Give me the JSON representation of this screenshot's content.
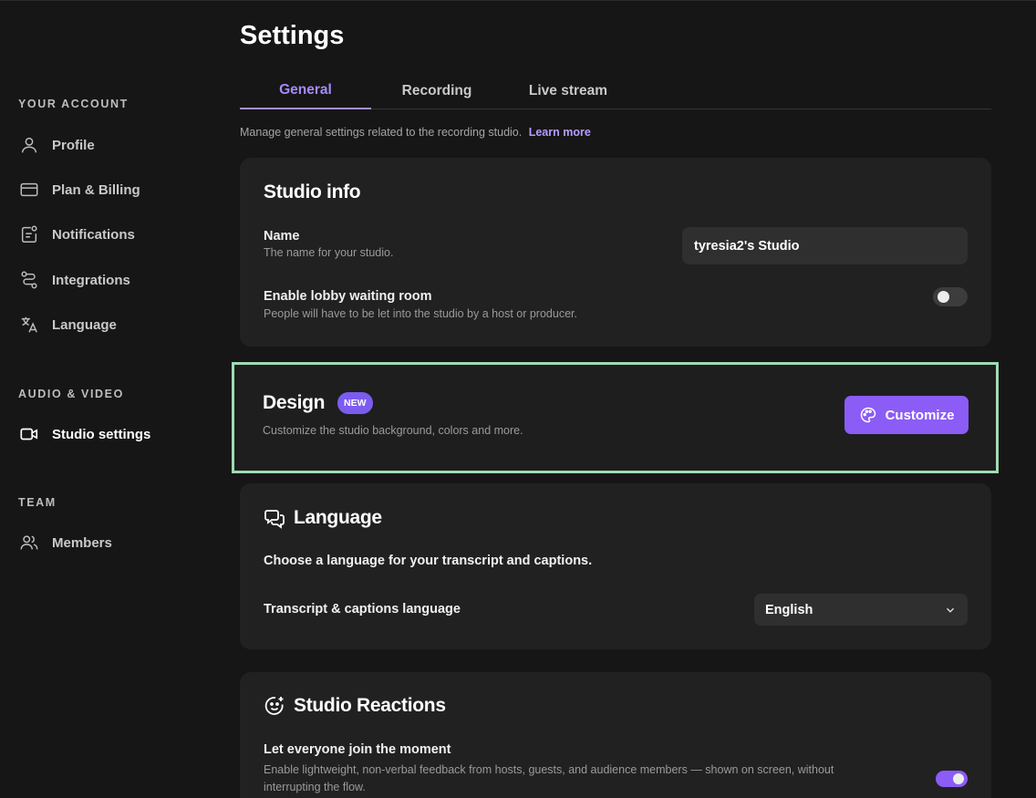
{
  "sidebar": {
    "sections": [
      {
        "heading": "YOUR ACCOUNT",
        "items": [
          {
            "label": "Profile",
            "icon": "user-icon"
          },
          {
            "label": "Plan & Billing",
            "icon": "credit-card-icon"
          },
          {
            "label": "Notifications",
            "icon": "notification-icon"
          },
          {
            "label": "Integrations",
            "icon": "integrations-icon"
          },
          {
            "label": "Language",
            "icon": "translate-icon"
          }
        ]
      },
      {
        "heading": "AUDIO & VIDEO",
        "items": [
          {
            "label": "Studio settings",
            "icon": "video-camera-icon",
            "active": true
          }
        ]
      },
      {
        "heading": "TEAM",
        "items": [
          {
            "label": "Members",
            "icon": "users-icon"
          }
        ]
      }
    ]
  },
  "page": {
    "title": "Settings",
    "tabs": [
      {
        "label": "General",
        "active": true
      },
      {
        "label": "Recording",
        "active": false
      },
      {
        "label": "Live stream",
        "active": false
      }
    ],
    "description": "Manage general settings related to the recording studio.",
    "learn_more": "Learn more"
  },
  "studio_info": {
    "title": "Studio info",
    "name_label": "Name",
    "name_sub": "The name for your studio.",
    "name_value": "tyresia2's Studio",
    "lobby_label": "Enable lobby waiting room",
    "lobby_sub": "People will have to be let into the studio by a host or producer.",
    "lobby_enabled": false
  },
  "design": {
    "title": "Design",
    "badge": "NEW",
    "sub": "Customize the studio background, colors and more.",
    "button": "Customize"
  },
  "language": {
    "title": "Language",
    "intro": "Choose a language for your transcript and captions.",
    "field_label": "Transcript & captions language",
    "selected": "English"
  },
  "reactions": {
    "title": "Studio Reactions",
    "label": "Let everyone join the moment",
    "sub_line1": "Enable lightweight, non-verbal feedback from hosts, guests, and audience members — shown on screen, without",
    "sub_line2": "interrupting the flow.",
    "enabled": true
  },
  "colors": {
    "accent": "#8b5cf6",
    "tab_active": "#a78bfa",
    "highlight_border": "#9fdbb5",
    "background": "#161616",
    "card": "#212121"
  }
}
